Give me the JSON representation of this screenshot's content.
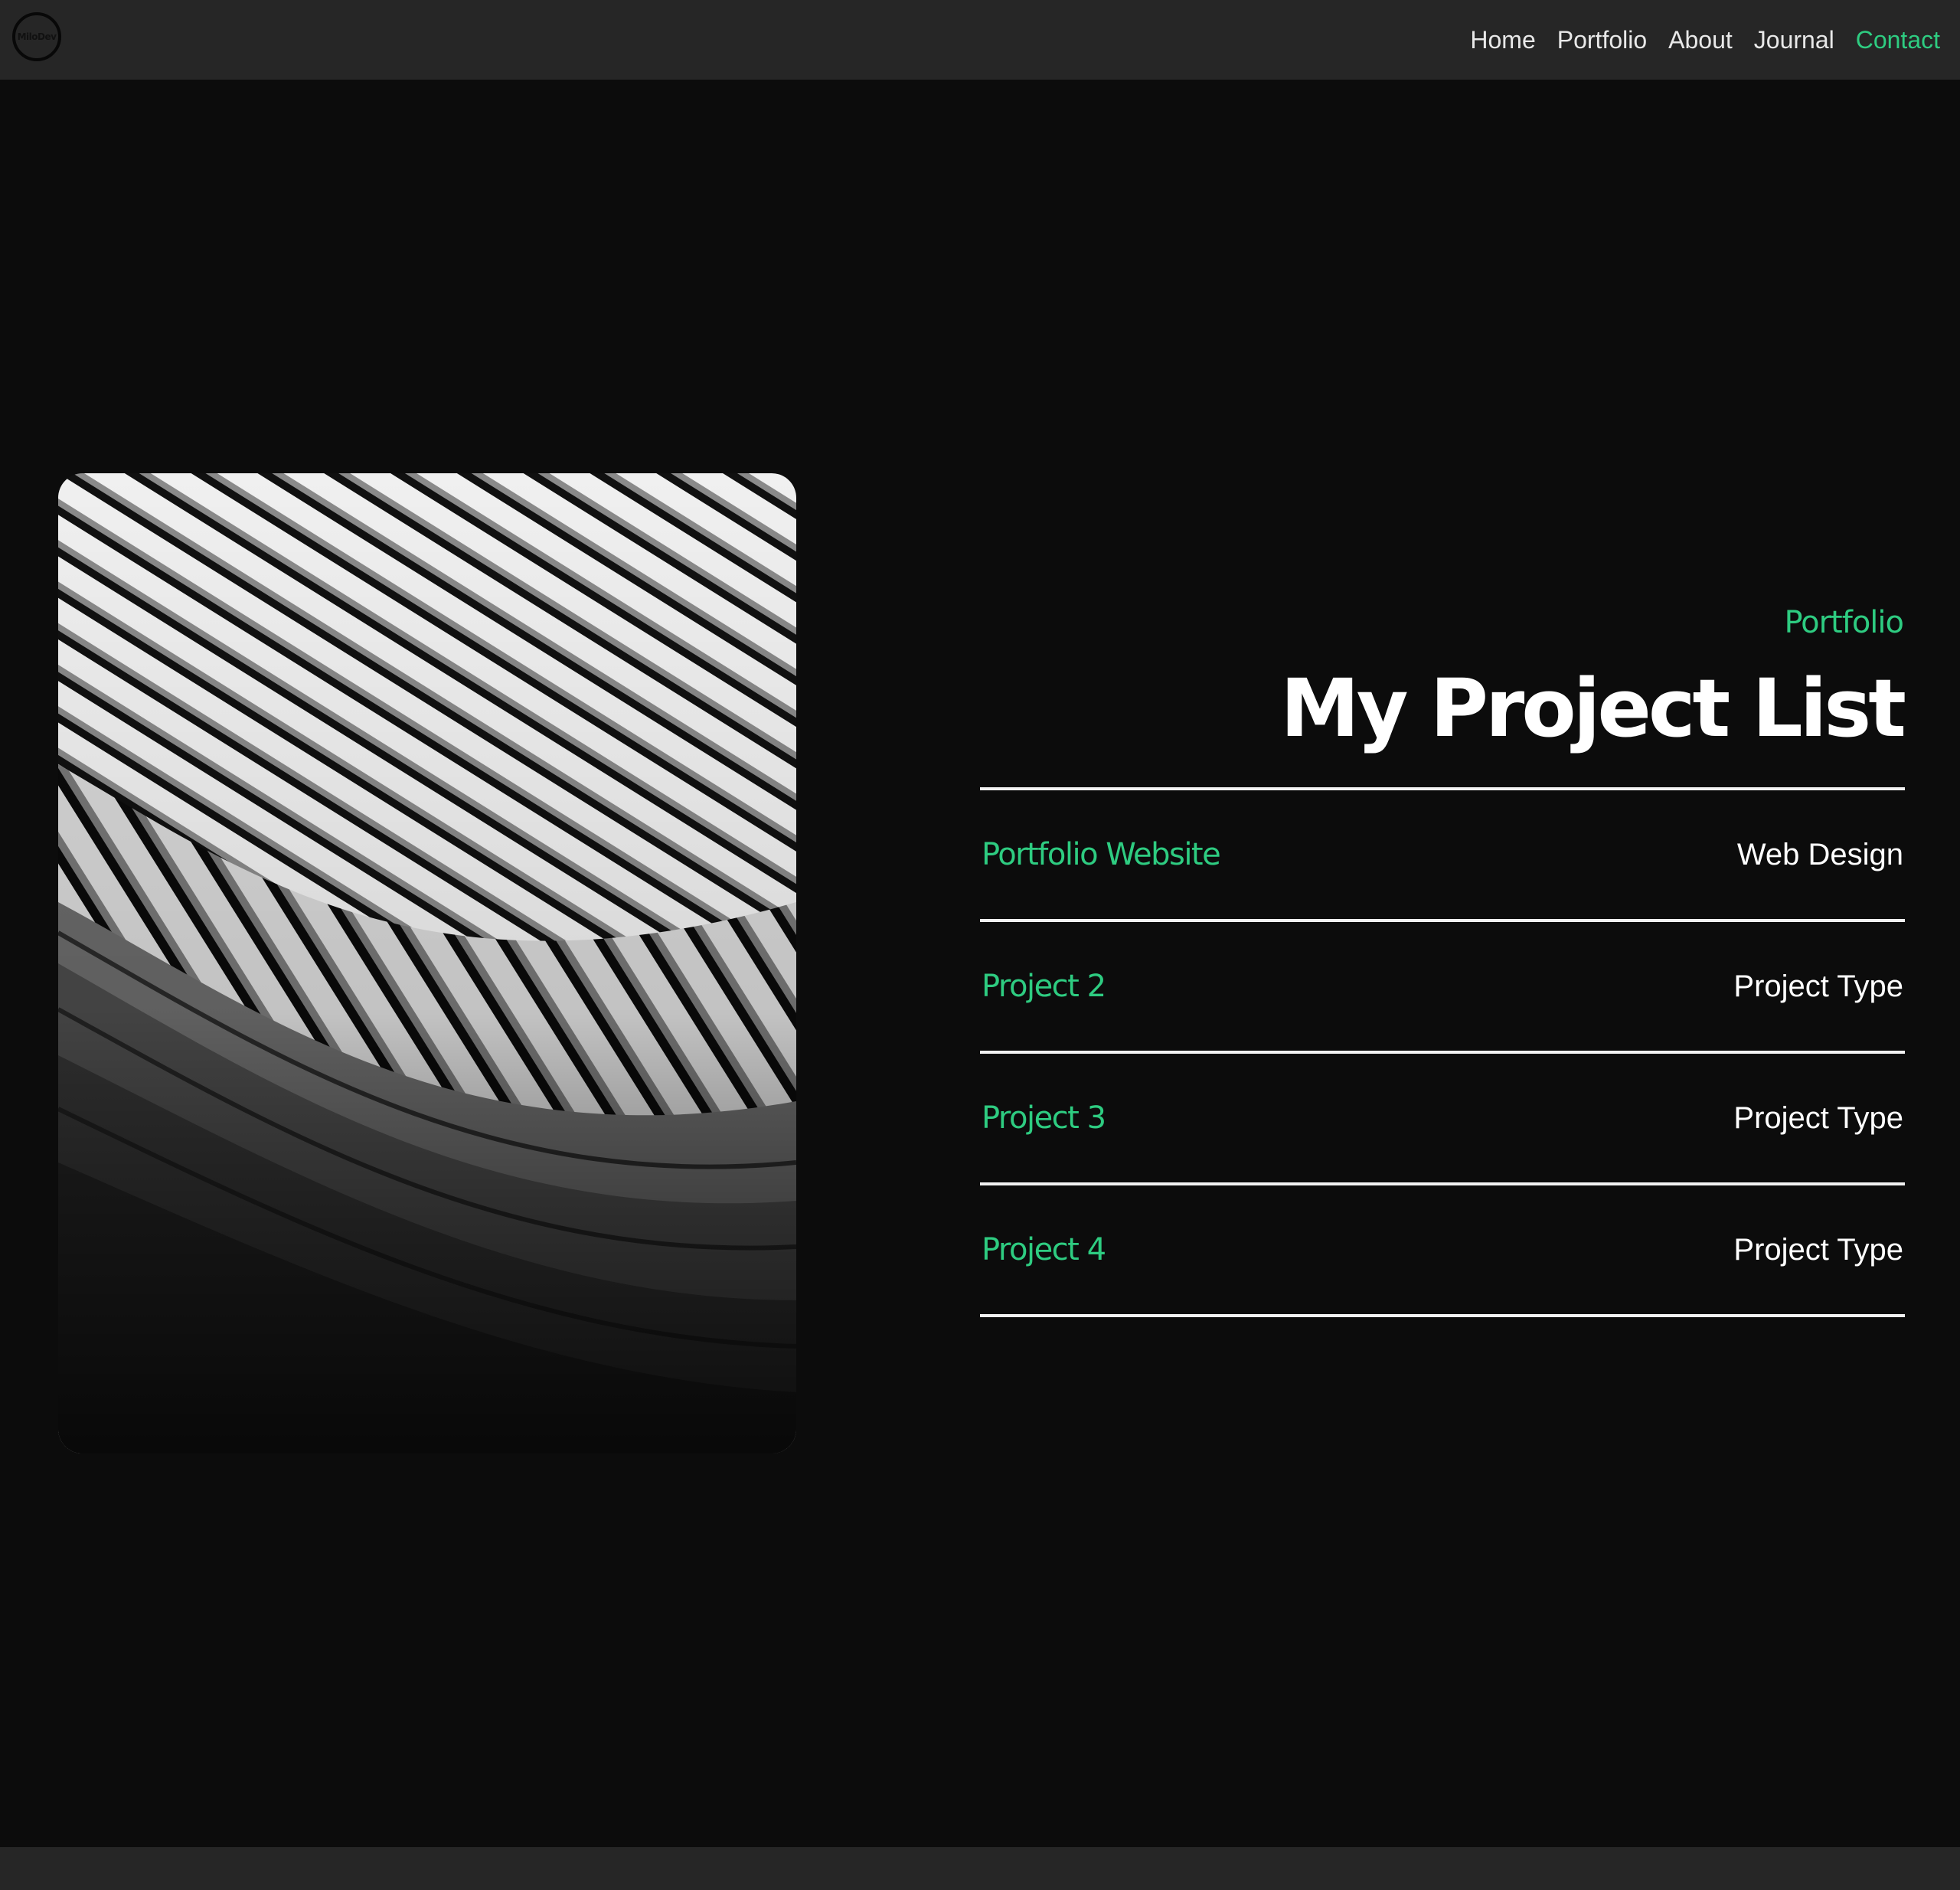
{
  "brand": {
    "logo_text": "MiloDev"
  },
  "nav": {
    "items": [
      {
        "label": "Home"
      },
      {
        "label": "Portfolio"
      },
      {
        "label": "About"
      },
      {
        "label": "Journal"
      },
      {
        "label": "Contact"
      }
    ],
    "active": "Contact"
  },
  "hero": {
    "eyebrow": "Portfolio",
    "title": "My Project List"
  },
  "projects": [
    {
      "name": "Portfolio Website",
      "type": "Web Design"
    },
    {
      "name": "Project 2",
      "type": "Project Type"
    },
    {
      "name": "Project 3",
      "type": "Project Type"
    },
    {
      "name": "Project 4",
      "type": "Project Type"
    }
  ],
  "colors": {
    "accent": "#2ecc81",
    "background": "#0c0c0c",
    "nav_background": "#262626",
    "text": "#ffffff"
  }
}
